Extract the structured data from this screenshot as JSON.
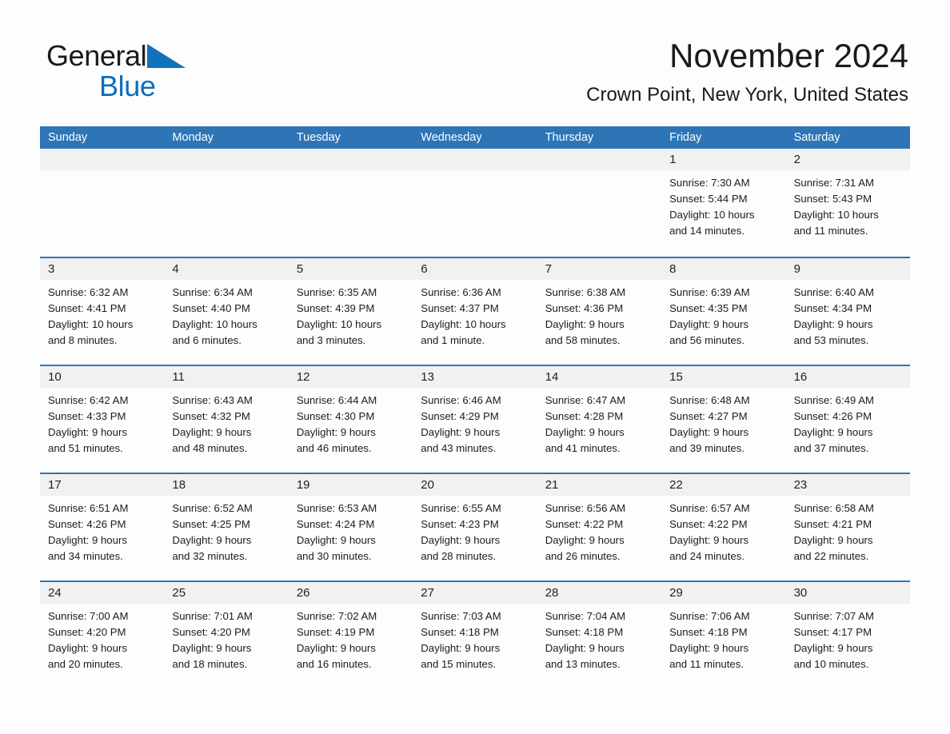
{
  "brand": {
    "word1": "General",
    "word2": "Blue",
    "triangle_color": "#1072bb",
    "text_color": "#1a1a1a"
  },
  "header": {
    "month_title": "November 2024",
    "location": "Crown Point, New York, United States"
  },
  "colors": {
    "header_blue": "#2e75b6",
    "row_separator_blue": "#2e75b6",
    "daynum_band": "#f1f1f1",
    "page_background": "#fdfdfd",
    "text": "#1c1c1c"
  },
  "weekdays": [
    "Sunday",
    "Monday",
    "Tuesday",
    "Wednesday",
    "Thursday",
    "Friday",
    "Saturday"
  ],
  "weeks": [
    [
      {
        "day": "",
        "lines": []
      },
      {
        "day": "",
        "lines": []
      },
      {
        "day": "",
        "lines": []
      },
      {
        "day": "",
        "lines": []
      },
      {
        "day": "",
        "lines": []
      },
      {
        "day": "1",
        "lines": [
          "Sunrise: 7:30 AM",
          "Sunset: 5:44 PM",
          "Daylight: 10 hours",
          "and 14 minutes."
        ]
      },
      {
        "day": "2",
        "lines": [
          "Sunrise: 7:31 AM",
          "Sunset: 5:43 PM",
          "Daylight: 10 hours",
          "and 11 minutes."
        ]
      }
    ],
    [
      {
        "day": "3",
        "lines": [
          "Sunrise: 6:32 AM",
          "Sunset: 4:41 PM",
          "Daylight: 10 hours",
          "and 8 minutes."
        ]
      },
      {
        "day": "4",
        "lines": [
          "Sunrise: 6:34 AM",
          "Sunset: 4:40 PM",
          "Daylight: 10 hours",
          "and 6 minutes."
        ]
      },
      {
        "day": "5",
        "lines": [
          "Sunrise: 6:35 AM",
          "Sunset: 4:39 PM",
          "Daylight: 10 hours",
          "and 3 minutes."
        ]
      },
      {
        "day": "6",
        "lines": [
          "Sunrise: 6:36 AM",
          "Sunset: 4:37 PM",
          "Daylight: 10 hours",
          "and 1 minute."
        ]
      },
      {
        "day": "7",
        "lines": [
          "Sunrise: 6:38 AM",
          "Sunset: 4:36 PM",
          "Daylight: 9 hours",
          "and 58 minutes."
        ]
      },
      {
        "day": "8",
        "lines": [
          "Sunrise: 6:39 AM",
          "Sunset: 4:35 PM",
          "Daylight: 9 hours",
          "and 56 minutes."
        ]
      },
      {
        "day": "9",
        "lines": [
          "Sunrise: 6:40 AM",
          "Sunset: 4:34 PM",
          "Daylight: 9 hours",
          "and 53 minutes."
        ]
      }
    ],
    [
      {
        "day": "10",
        "lines": [
          "Sunrise: 6:42 AM",
          "Sunset: 4:33 PM",
          "Daylight: 9 hours",
          "and 51 minutes."
        ]
      },
      {
        "day": "11",
        "lines": [
          "Sunrise: 6:43 AM",
          "Sunset: 4:32 PM",
          "Daylight: 9 hours",
          "and 48 minutes."
        ]
      },
      {
        "day": "12",
        "lines": [
          "Sunrise: 6:44 AM",
          "Sunset: 4:30 PM",
          "Daylight: 9 hours",
          "and 46 minutes."
        ]
      },
      {
        "day": "13",
        "lines": [
          "Sunrise: 6:46 AM",
          "Sunset: 4:29 PM",
          "Daylight: 9 hours",
          "and 43 minutes."
        ]
      },
      {
        "day": "14",
        "lines": [
          "Sunrise: 6:47 AM",
          "Sunset: 4:28 PM",
          "Daylight: 9 hours",
          "and 41 minutes."
        ]
      },
      {
        "day": "15",
        "lines": [
          "Sunrise: 6:48 AM",
          "Sunset: 4:27 PM",
          "Daylight: 9 hours",
          "and 39 minutes."
        ]
      },
      {
        "day": "16",
        "lines": [
          "Sunrise: 6:49 AM",
          "Sunset: 4:26 PM",
          "Daylight: 9 hours",
          "and 37 minutes."
        ]
      }
    ],
    [
      {
        "day": "17",
        "lines": [
          "Sunrise: 6:51 AM",
          "Sunset: 4:26 PM",
          "Daylight: 9 hours",
          "and 34 minutes."
        ]
      },
      {
        "day": "18",
        "lines": [
          "Sunrise: 6:52 AM",
          "Sunset: 4:25 PM",
          "Daylight: 9 hours",
          "and 32 minutes."
        ]
      },
      {
        "day": "19",
        "lines": [
          "Sunrise: 6:53 AM",
          "Sunset: 4:24 PM",
          "Daylight: 9 hours",
          "and 30 minutes."
        ]
      },
      {
        "day": "20",
        "lines": [
          "Sunrise: 6:55 AM",
          "Sunset: 4:23 PM",
          "Daylight: 9 hours",
          "and 28 minutes."
        ]
      },
      {
        "day": "21",
        "lines": [
          "Sunrise: 6:56 AM",
          "Sunset: 4:22 PM",
          "Daylight: 9 hours",
          "and 26 minutes."
        ]
      },
      {
        "day": "22",
        "lines": [
          "Sunrise: 6:57 AM",
          "Sunset: 4:22 PM",
          "Daylight: 9 hours",
          "and 24 minutes."
        ]
      },
      {
        "day": "23",
        "lines": [
          "Sunrise: 6:58 AM",
          "Sunset: 4:21 PM",
          "Daylight: 9 hours",
          "and 22 minutes."
        ]
      }
    ],
    [
      {
        "day": "24",
        "lines": [
          "Sunrise: 7:00 AM",
          "Sunset: 4:20 PM",
          "Daylight: 9 hours",
          "and 20 minutes."
        ]
      },
      {
        "day": "25",
        "lines": [
          "Sunrise: 7:01 AM",
          "Sunset: 4:20 PM",
          "Daylight: 9 hours",
          "and 18 minutes."
        ]
      },
      {
        "day": "26",
        "lines": [
          "Sunrise: 7:02 AM",
          "Sunset: 4:19 PM",
          "Daylight: 9 hours",
          "and 16 minutes."
        ]
      },
      {
        "day": "27",
        "lines": [
          "Sunrise: 7:03 AM",
          "Sunset: 4:18 PM",
          "Daylight: 9 hours",
          "and 15 minutes."
        ]
      },
      {
        "day": "28",
        "lines": [
          "Sunrise: 7:04 AM",
          "Sunset: 4:18 PM",
          "Daylight: 9 hours",
          "and 13 minutes."
        ]
      },
      {
        "day": "29",
        "lines": [
          "Sunrise: 7:06 AM",
          "Sunset: 4:18 PM",
          "Daylight: 9 hours",
          "and 11 minutes."
        ]
      },
      {
        "day": "30",
        "lines": [
          "Sunrise: 7:07 AM",
          "Sunset: 4:17 PM",
          "Daylight: 9 hours",
          "and 10 minutes."
        ]
      }
    ]
  ]
}
